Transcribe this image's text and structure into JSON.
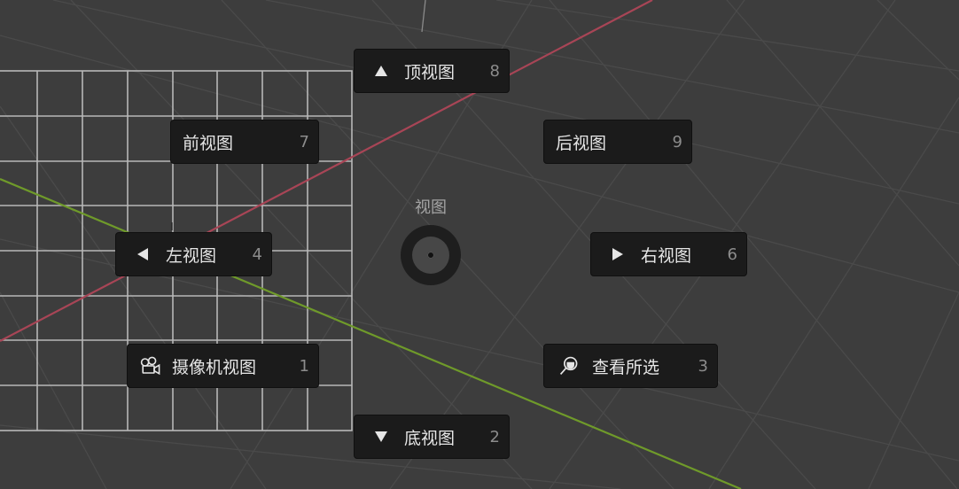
{
  "pie_menu": {
    "title": "视图",
    "items": {
      "top": {
        "label": "顶视图",
        "hotkey": "8",
        "icon": "triangle-up-icon"
      },
      "front": {
        "label": "前视图",
        "hotkey": "7"
      },
      "back": {
        "label": "后视图",
        "hotkey": "9"
      },
      "left": {
        "label": "左视图",
        "hotkey": "4",
        "icon": "triangle-left-icon"
      },
      "right": {
        "label": "右视图",
        "hotkey": "6",
        "icon": "triangle-right-icon"
      },
      "camera": {
        "label": "摄像机视图",
        "hotkey": "1",
        "icon": "camera-icon"
      },
      "selected": {
        "label": "查看所选",
        "hotkey": "3",
        "icon": "zoom-selected-icon"
      },
      "bottom": {
        "label": "底视图",
        "hotkey": "2",
        "icon": "triangle-down-icon"
      }
    }
  },
  "colors": {
    "background": "#3d3d3d",
    "grid": "#4a4a4a",
    "x_axis": "#a84556",
    "y_axis": "#6f9a2a",
    "menu_item_bg": "#1b1b1b"
  }
}
